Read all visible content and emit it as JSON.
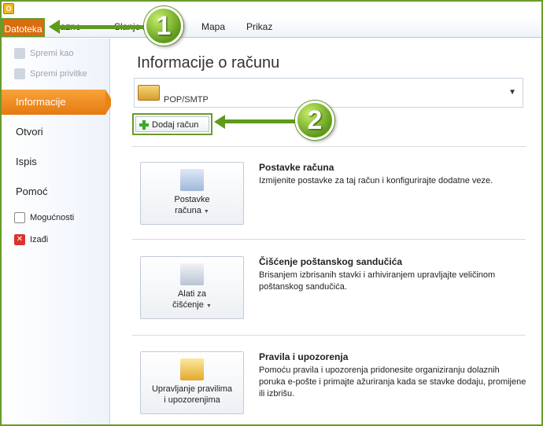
{
  "ribbon": {
    "file_tab": "Datoteka",
    "tabs": [
      "Slanje /",
      "Mapa",
      "Prikaz"
    ],
    "partial_tab": "lazno"
  },
  "nav": {
    "disabled": [
      {
        "label": "Spremi kao",
        "icon": "save-as-icon"
      },
      {
        "label": "Spremi privitke",
        "icon": "save-attachments-icon"
      }
    ],
    "items": [
      {
        "label": "Informacije",
        "selected": true
      },
      {
        "label": "Otvori"
      },
      {
        "label": "Ispis"
      },
      {
        "label": "Pomoć"
      }
    ],
    "mini": [
      {
        "label": "Mogućnosti",
        "icon": "options-icon"
      },
      {
        "label": "Izađi",
        "icon": "exit-icon",
        "icon_color": "#d9342b"
      }
    ]
  },
  "main": {
    "title": "Informacije o računu",
    "account": {
      "type": "POP/SMTP"
    },
    "add_account": "Dodaj račun",
    "sections": [
      {
        "button_line1": "Postavke",
        "button_line2": "računa",
        "title": "Postavke računa",
        "desc": "Izmijenite postavke za taj račun i konfigurirajte dodatne veze.",
        "icon": "account-settings-icon"
      },
      {
        "button_line1": "Alati za",
        "button_line2": "čišćenje",
        "title": "Čišćenje poštanskog sandučića",
        "desc": "Brisanjem izbrisanih stavki i arhiviranjem upravljajte veličinom poštanskog sandučića.",
        "icon": "cleanup-tools-icon"
      },
      {
        "button_line1": "Upravljanje pravilima",
        "button_line2": "i upozorenjima",
        "title": "Pravila i upozorenja",
        "desc": "Pomoću pravila i upozorenja pridonesite organiziranju dolaznih poruka e-pošte i primajte ažuriranja kada se stavke dodaju, promijene ili izbrišu.",
        "icon": "rules-alerts-icon"
      }
    ]
  },
  "callouts": [
    "1",
    "2"
  ],
  "colors": {
    "accent_orange": "#e57a10",
    "callout_green": "#5f9b1a"
  }
}
